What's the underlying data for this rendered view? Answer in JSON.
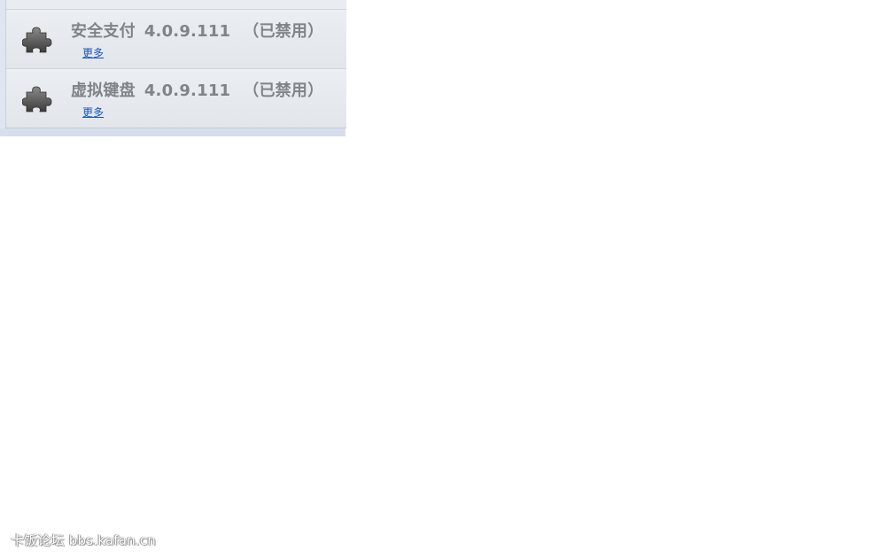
{
  "extensions": [
    {
      "name": "安全支付",
      "version": "4.0.9.111",
      "status": "（已禁用）",
      "more_label": "更多"
    },
    {
      "name": "虚拟键盘",
      "version": "4.0.9.111",
      "status": "（已禁用）",
      "more_label": "更多"
    }
  ],
  "icon": "puzzle-piece-icon",
  "watermark": "卡饭论坛 bbs.kafan.cn"
}
